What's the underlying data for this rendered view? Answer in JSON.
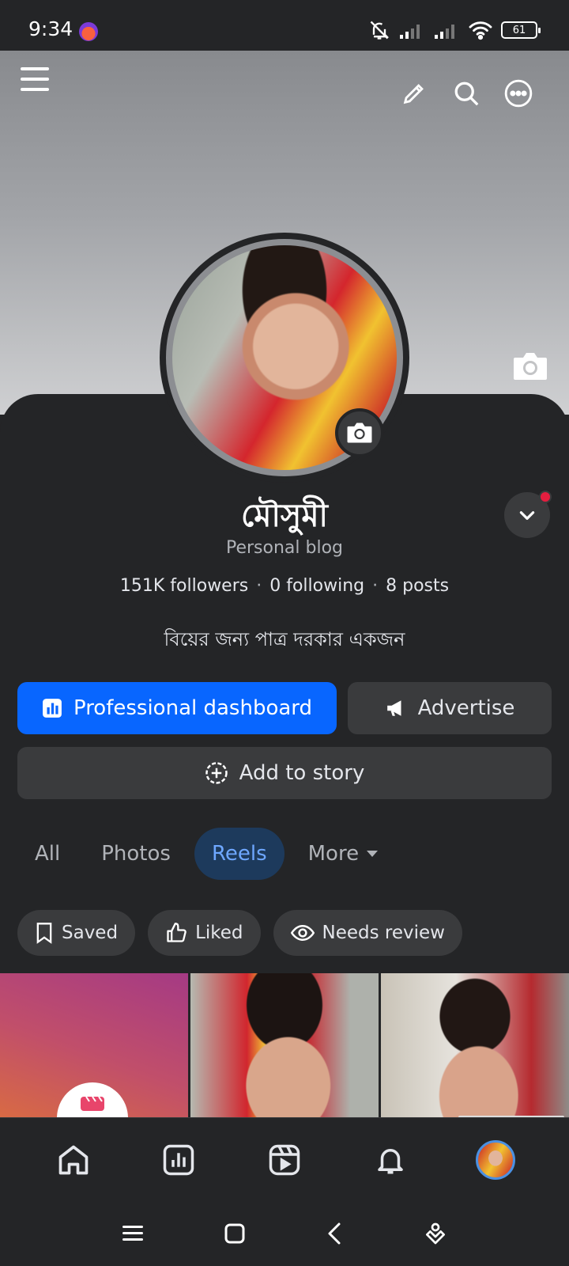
{
  "status_bar": {
    "time": "9:34",
    "battery": "61"
  },
  "profile": {
    "name": "মৌসুমী",
    "category": "Personal blog",
    "followers": "151K followers",
    "following": "0 following",
    "posts": "8 posts",
    "bio": "বিয়ের জন্য পাত্র দরকার একজন"
  },
  "actions": {
    "professional_dashboard": "Professional dashboard",
    "advertise": "Advertise",
    "add_to_story": "Add to story"
  },
  "tabs": [
    {
      "label": "All",
      "active": false
    },
    {
      "label": "Photos",
      "active": false
    },
    {
      "label": "Reels",
      "active": true
    },
    {
      "label": "More",
      "active": false
    }
  ],
  "filters": [
    {
      "label": "Saved",
      "icon": "bookmark-icon"
    },
    {
      "label": "Liked",
      "icon": "thumbs-up-icon"
    },
    {
      "label": "Needs review",
      "icon": "eye-icon"
    }
  ],
  "bottom_nav": [
    "home-icon",
    "dashboard-icon",
    "reels-icon",
    "bell-icon",
    "profile-avatar"
  ],
  "colors": {
    "background": "#242527",
    "primary": "#0866ff",
    "secondary_button": "#3a3b3d",
    "active_tab_bg": "#1d3a5c",
    "active_tab_text": "#6ea7ff",
    "notification": "#e41e3f"
  }
}
